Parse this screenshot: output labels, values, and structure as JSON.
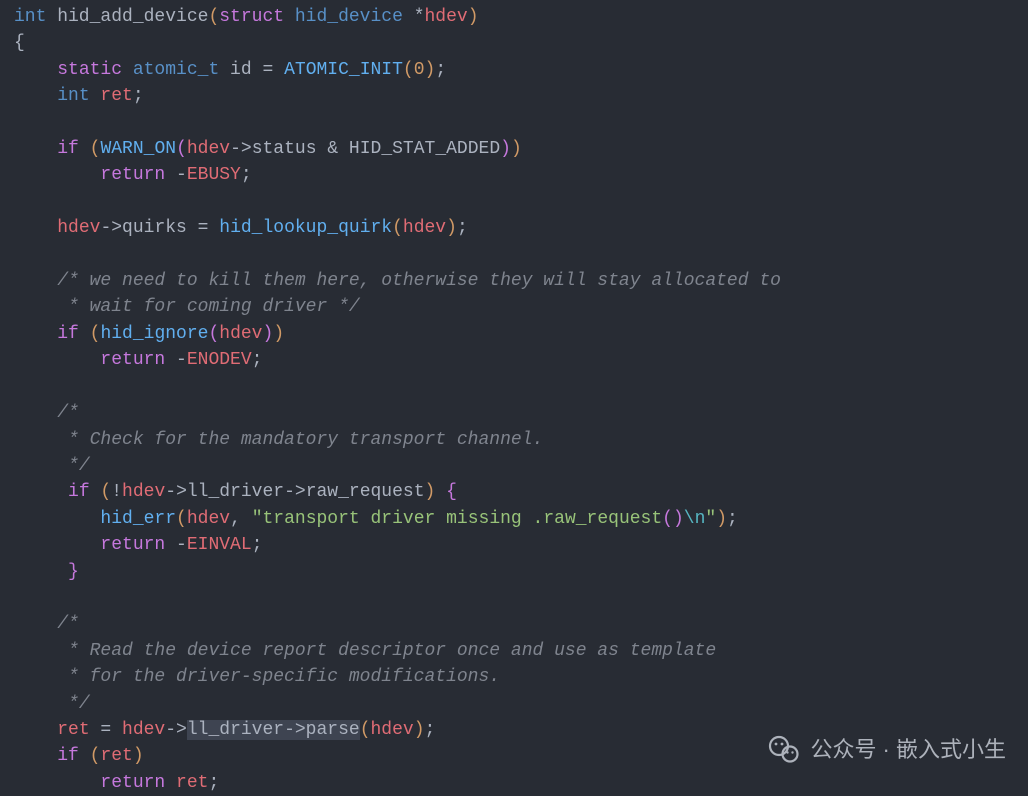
{
  "code": {
    "l1_int": "int",
    "l1_fn": " hid_add_device",
    "l1_paren_o": "(",
    "l1_struct": "struct",
    "l1_hiddevice": " hid_device ",
    "l1_star": "*",
    "l1_hdev": "hdev",
    "l1_paren_c": ")",
    "l2_brace": "{",
    "l3_static": "static",
    "l3_atomic": " atomic_t",
    "l3_id": " id ",
    "l3_eq": "=",
    "l3_sp": " ",
    "l3_atomic_init": "ATOMIC_INIT",
    "l3_po": "(",
    "l3_zero": "0",
    "l3_pc": ")",
    "l3_semi": ";",
    "l4_int": "int",
    "l4_ret": " ret",
    "l4_semi": ";",
    "l6_if": "if",
    "l6_po1": " (",
    "l6_warnon": "WARN_ON",
    "l6_po2": "(",
    "l6_hdev": "hdev",
    "l6_arrow_status": "->status ",
    "l6_amp": "& HID_STAT_ADDED",
    "l6_pc2": ")",
    "l6_pc1": ")",
    "l7_return": "return",
    "l7_neg": " -",
    "l7_ebusy": "EBUSY",
    "l7_semi": ";",
    "l9_hdev": "hdev",
    "l9_arrow_quirks": "->quirks ",
    "l9_eq": "= ",
    "l9_lookup": "hid_lookup_quirk",
    "l9_po": "(",
    "l9_hdev2": "hdev",
    "l9_pc": ")",
    "l9_semi": ";",
    "c1": "/* we need to kill them here, otherwise they will stay allocated to",
    "c2": " * wait for coming driver */",
    "l12_if": "if",
    "l12_po": " (",
    "l12_ignore": "hid_ignore",
    "l12_po2": "(",
    "l12_hdev": "hdev",
    "l12_pc2": ")",
    "l12_pc": ")",
    "l13_return": "return",
    "l13_neg": " -",
    "l13_enodev": "ENODEV",
    "l13_semi": ";",
    "c3": "/*",
    "c4": " * Check for the mandatory transport channel.",
    "c5": " */",
    "l17_if": "if",
    "l17_po": " (",
    "l17_not": "!",
    "l17_hdev": "hdev",
    "l17_arrow1": "->ll_driver",
    "l17_arrow2": "->raw_request",
    "l17_pc": ")",
    "l17_brace": " {",
    "l18_hiderr": "hid_err",
    "l18_po": "(",
    "l18_hdev": "hdev",
    "l18_comma": ", ",
    "l18_str1": "\"transport driver missing .raw_request",
    "l18_str_paren": "()",
    "l18_str_esc": "\\n",
    "l18_str2": "\"",
    "l18_pc": ")",
    "l18_semi": ";",
    "l19_return": "return",
    "l19_neg": " -",
    "l19_einval": "EINVAL",
    "l19_semi": ";",
    "l20_brace": "}",
    "c6": "/*",
    "c7": " * Read the device report descriptor once and use as template",
    "c8": " * for the driver-specific modifications.",
    "c9": " */",
    "l25_ret": "ret",
    "l25_eq": " = ",
    "l25_hdev": "hdev",
    "l25_arrow": "->",
    "l25_hl": "ll_driver->parse",
    "l25_po": "(",
    "l25_hdev2": "hdev",
    "l25_pc": ")",
    "l25_semi": ";",
    "l26_if": "if",
    "l26_po": " (",
    "l26_ret": "ret",
    "l26_pc": ")",
    "l27_return": "return",
    "l27_ret": " ret",
    "l27_semi": ";"
  },
  "watermark": {
    "text": "公众号 · 嵌入式小生"
  }
}
